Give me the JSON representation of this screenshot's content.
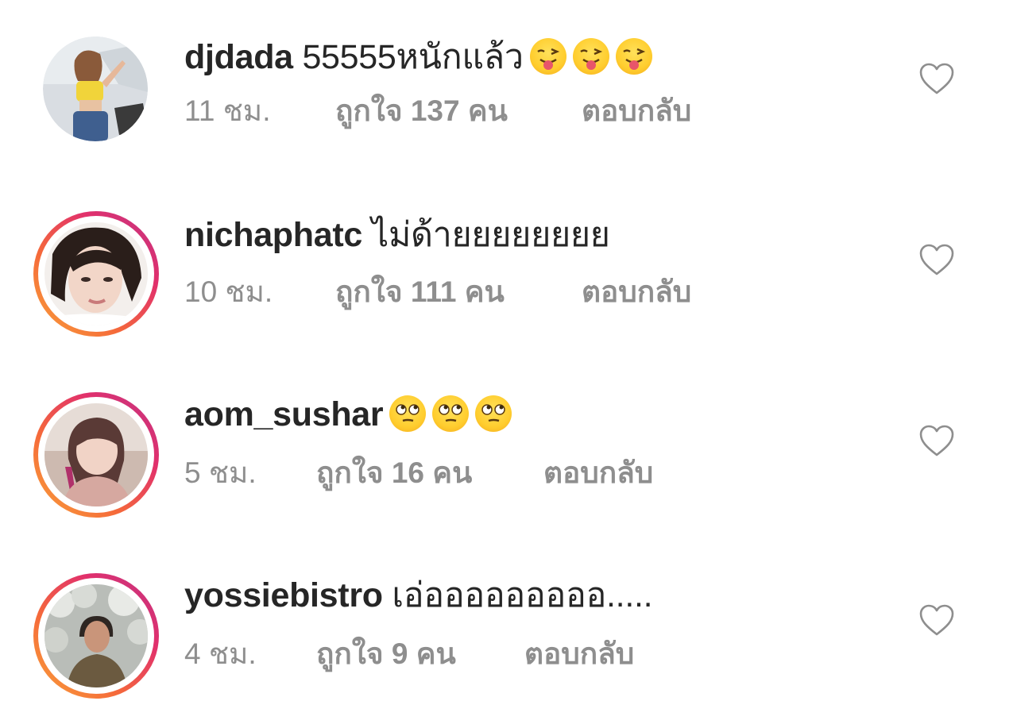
{
  "comments": [
    {
      "username": "djdada",
      "text": "55555หนักแล้ว",
      "emoji": [
        "tongue-wink",
        "tongue-wink",
        "tongue-wink"
      ],
      "time": "11 ชม.",
      "likes": "ถูกใจ 137 คน",
      "reply": "ตอบกลับ",
      "story_ring": false
    },
    {
      "username": "nichaphatc",
      "text": "ไม่ด้ายยยยยยยย",
      "emoji": [],
      "time": "10 ชม.",
      "likes": "ถูกใจ 111 คน",
      "reply": "ตอบกลับ",
      "story_ring": true
    },
    {
      "username": "aom_sushar",
      "text": "",
      "emoji": [
        "rolling-eyes",
        "rolling-eyes",
        "rolling-eyes"
      ],
      "time": "5 ชม.",
      "likes": "ถูกใจ 16 คน",
      "reply": "ตอบกลับ",
      "story_ring": true
    },
    {
      "username": "yossiebistro",
      "text": "เอ่อออออออออ.....",
      "emoji": [],
      "time": "4 ชม.",
      "likes": "ถูกใจ 9 คน",
      "reply": "ตอบกลับ",
      "story_ring": true
    }
  ],
  "colors": {
    "text_primary": "#262626",
    "text_secondary": "#8e8e8e",
    "ring_start": "#f9a33a",
    "ring_end": "#c13584"
  },
  "icons": {
    "like": "heart-outline-icon"
  }
}
